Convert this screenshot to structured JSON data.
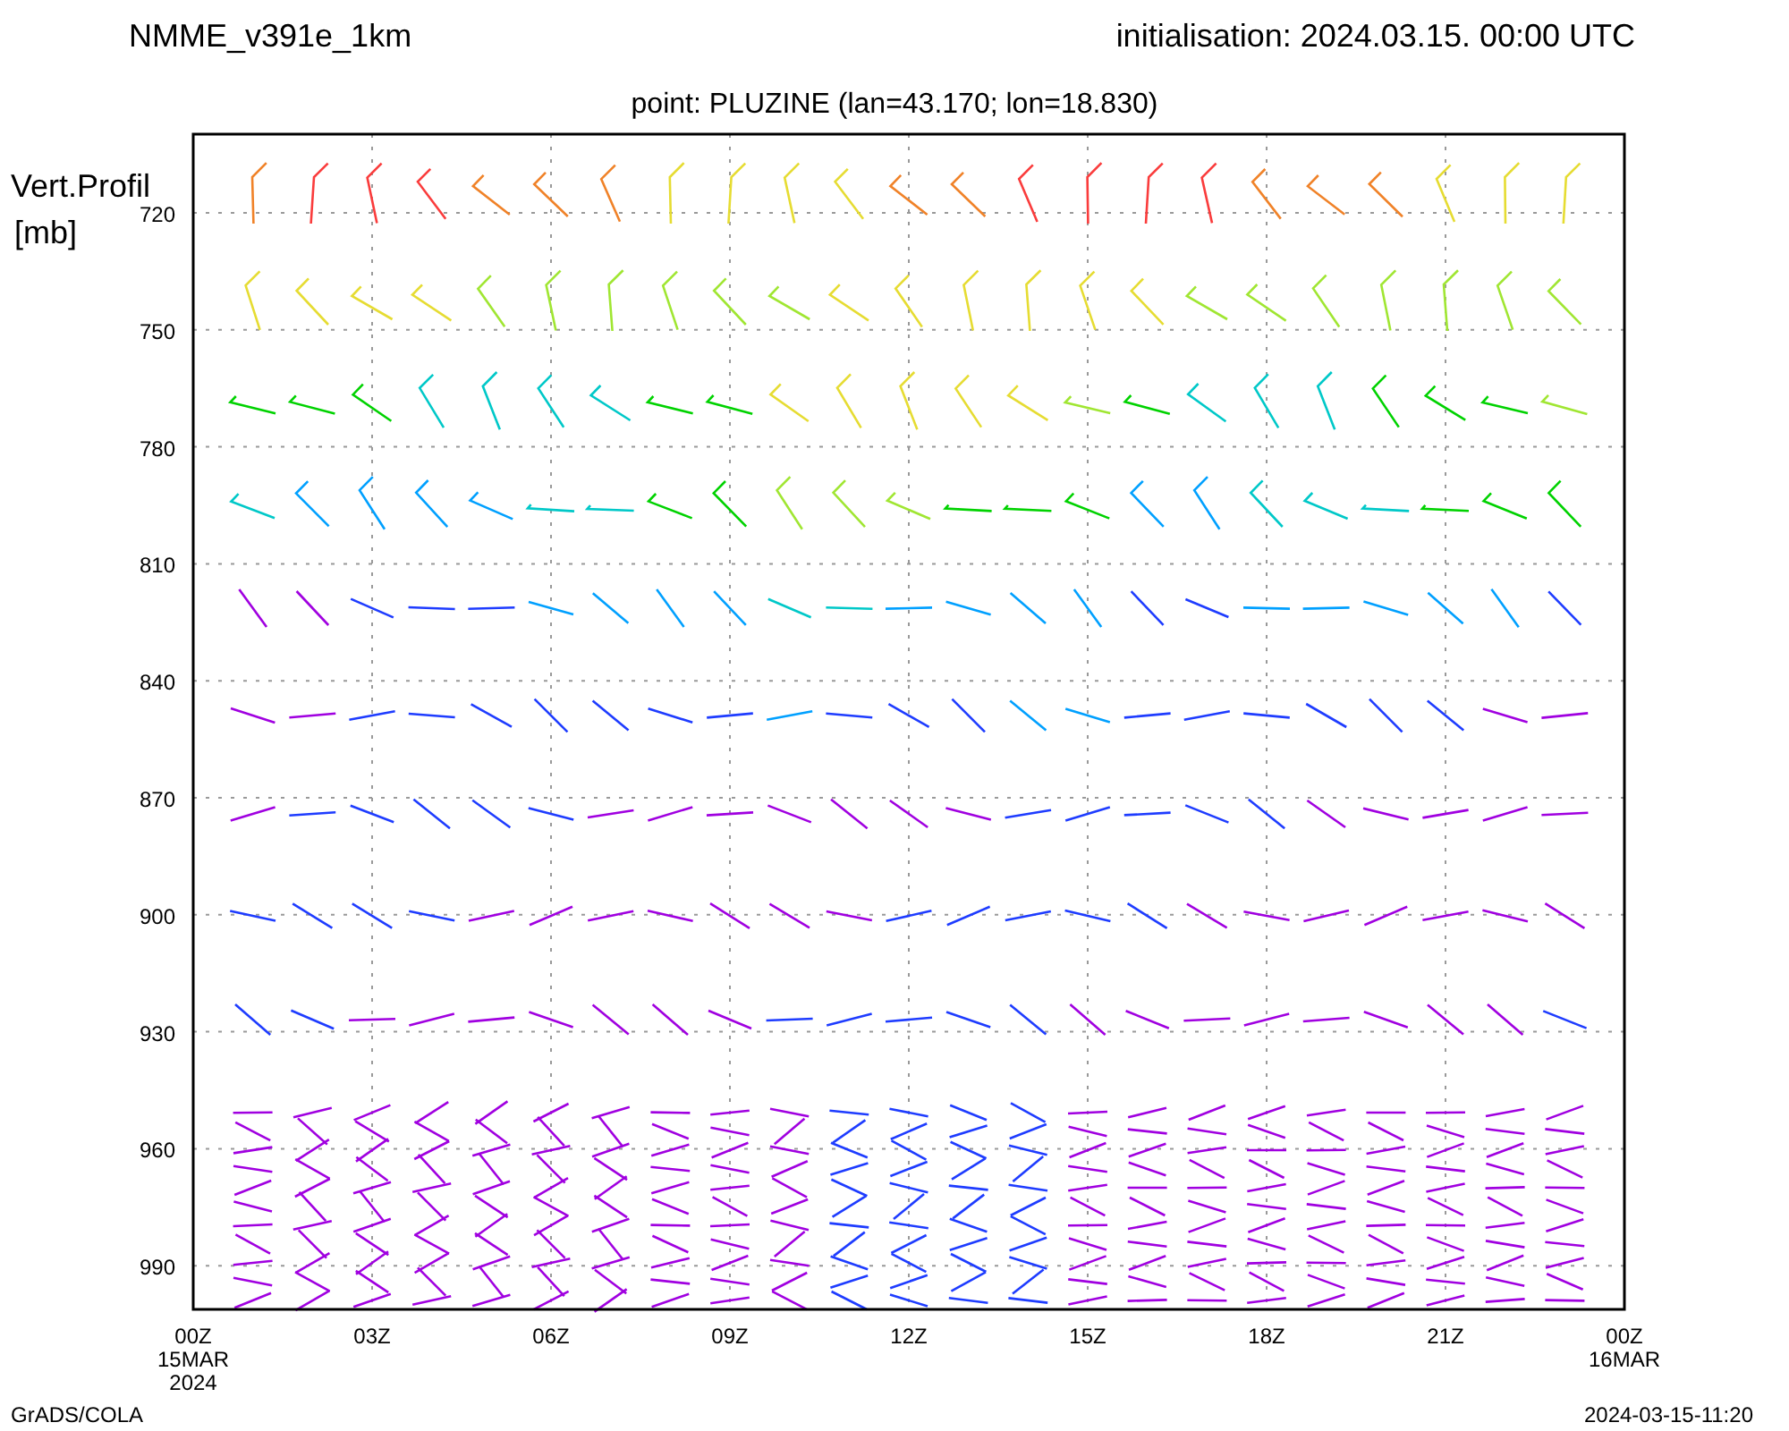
{
  "header": {
    "model": "NMME_v391e_1km",
    "initialisation": "initialisation: 2024.03.15. 00:00 UTC",
    "point": "point: PLUZINE (lan=43.170; lon=18.830)"
  },
  "y_axis": {
    "title_lines": [
      "Vert.Profil",
      "[mb]"
    ],
    "ticks": [
      "720",
      "750",
      "780",
      "810",
      "840",
      "870",
      "900",
      "930",
      "960",
      "990"
    ]
  },
  "x_axis": {
    "ticks": [
      {
        "label": "00Z",
        "sub": [
          "15MAR",
          "2024"
        ]
      },
      {
        "label": "03Z"
      },
      {
        "label": "06Z"
      },
      {
        "label": "09Z"
      },
      {
        "label": "12Z"
      },
      {
        "label": "15Z"
      },
      {
        "label": "18Z"
      },
      {
        "label": "21Z"
      },
      {
        "label": "00Z",
        "sub": [
          "16MAR"
        ]
      }
    ]
  },
  "footer": {
    "left": "GrADS/COLA",
    "right": "2024-03-15-11:20"
  }
}
